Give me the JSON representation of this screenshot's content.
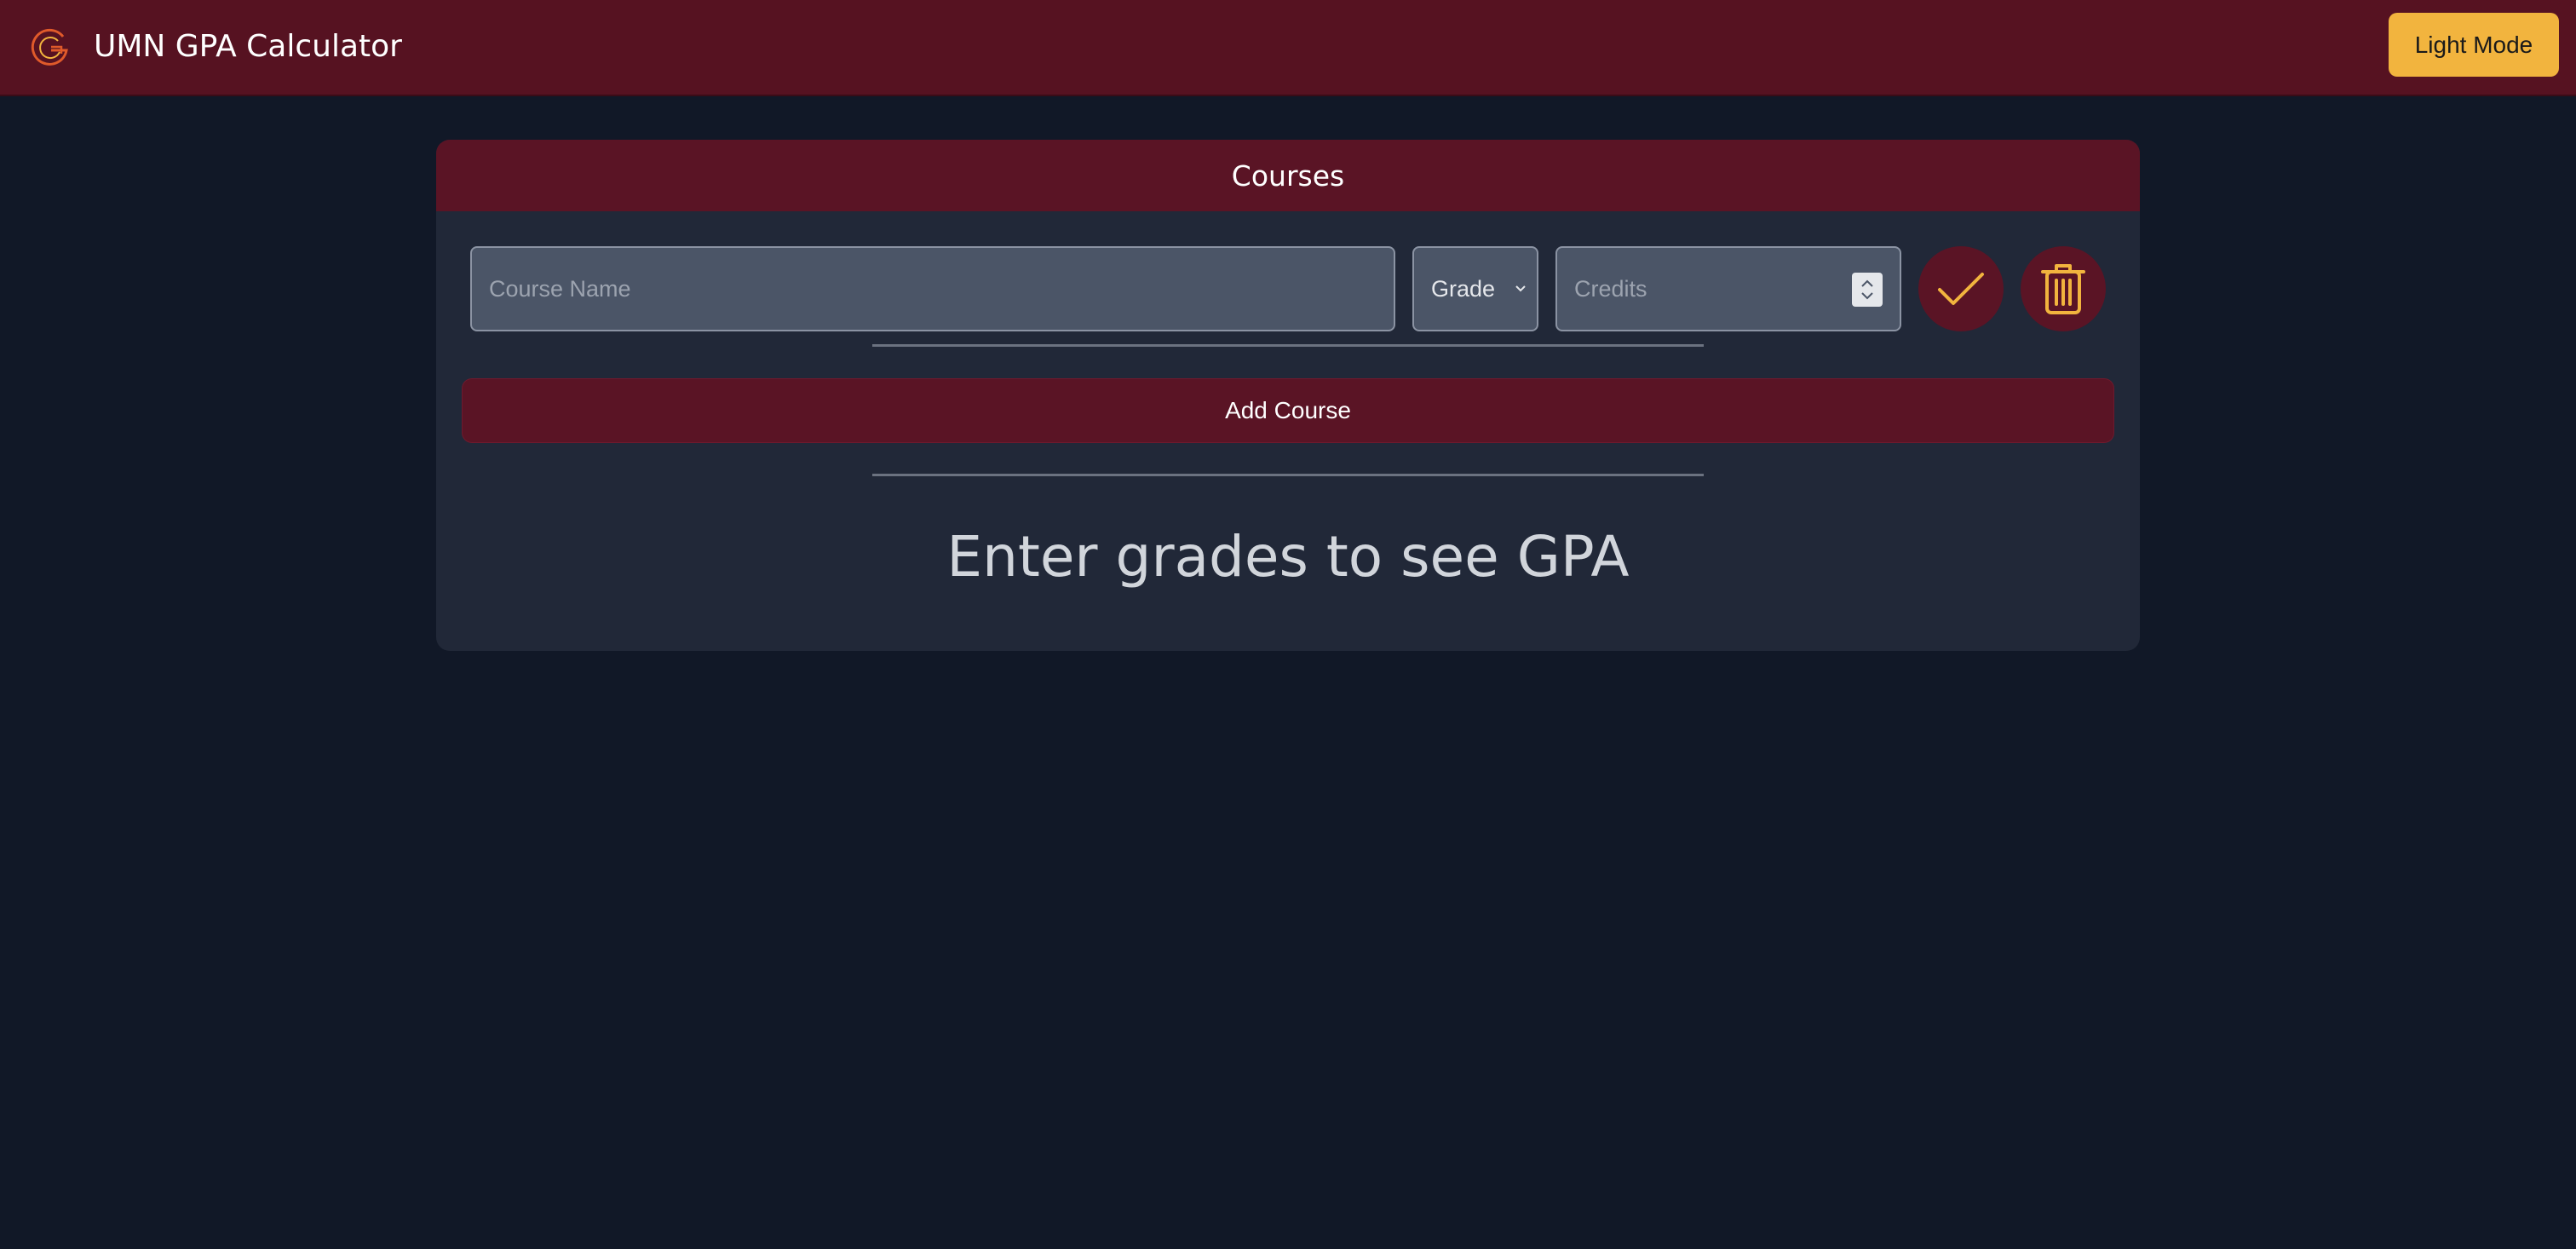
{
  "header": {
    "app_title": "UMN GPA Calculator",
    "logo_icon": "g-logo-icon",
    "mode_button_label": "Light Mode"
  },
  "courses_card": {
    "title": "Courses",
    "course_row": {
      "course_name_placeholder": "Course Name",
      "course_name_value": "",
      "grade_selected": "Grade",
      "credits_placeholder": "Credits",
      "credits_value": "",
      "confirm_icon": "check-icon",
      "delete_icon": "trash-icon"
    },
    "add_course_label": "Add Course",
    "gpa_message": "Enter grades to see GPA"
  },
  "colors": {
    "background": "#111827",
    "navbar": "#561221",
    "card": "#212838",
    "maroon_accent": "#5a1425",
    "gold_accent": "#f2b43e"
  }
}
